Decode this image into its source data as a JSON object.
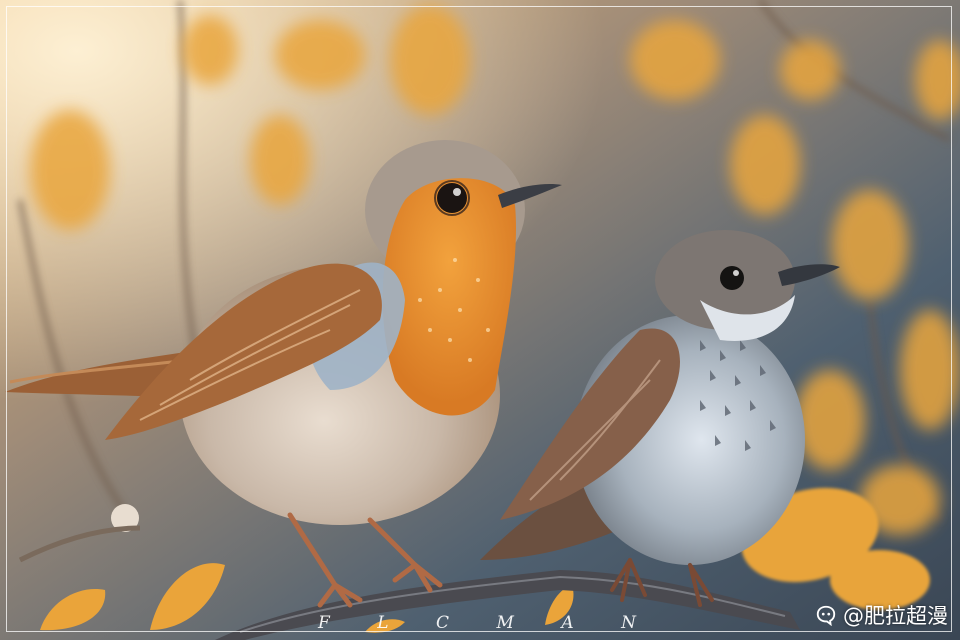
{
  "scene": {
    "subject": "two small songbirds perched on a branch",
    "colors": {
      "background_warm": "#d8a160",
      "background_cool": "#4e6172",
      "leaf": "#e8a43a",
      "robin_breast": "#e48a2e",
      "bird_grey": "#8b95a0"
    }
  },
  "signature": {
    "letters": [
      "F",
      "L",
      "C",
      "M",
      "A",
      "N"
    ]
  },
  "watermark": {
    "icon": "chat-bubble-icon",
    "text": "@肥拉超漫"
  }
}
